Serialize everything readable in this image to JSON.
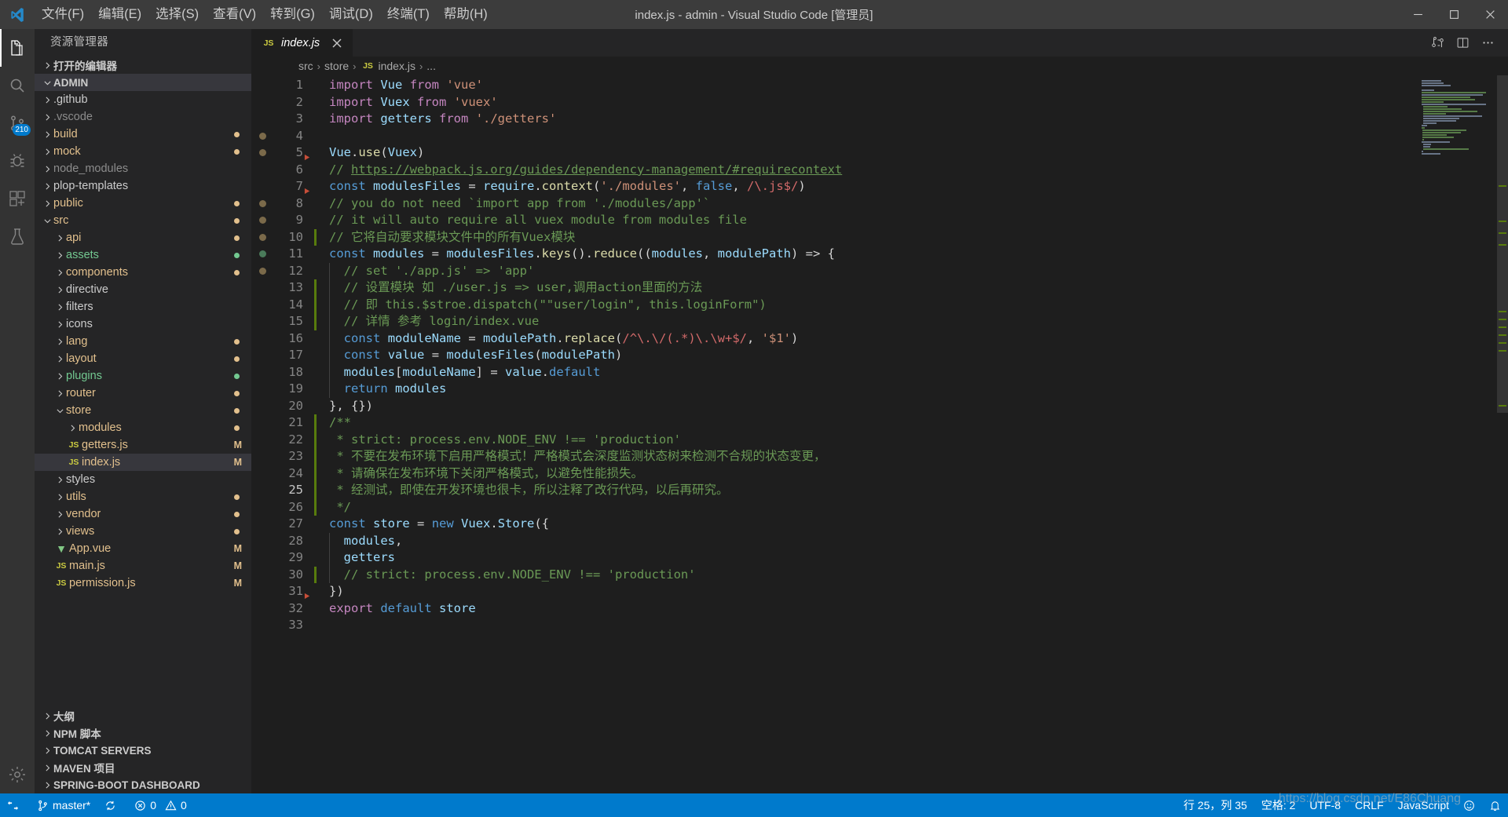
{
  "window": {
    "title": "index.js - admin - Visual Studio Code [管理员]",
    "minimize": "最小化",
    "maximize": "最大化",
    "close": "关闭"
  },
  "menubar": [
    {
      "label": "文件(F)"
    },
    {
      "label": "编辑(E)"
    },
    {
      "label": "选择(S)"
    },
    {
      "label": "查看(V)"
    },
    {
      "label": "转到(G)"
    },
    {
      "label": "调试(D)"
    },
    {
      "label": "终端(T)"
    },
    {
      "label": "帮助(H)"
    }
  ],
  "activitybar": [
    {
      "name": "explorer",
      "icon": "files-icon",
      "active": true,
      "badge": ""
    },
    {
      "name": "search",
      "icon": "search-icon",
      "active": false,
      "badge": ""
    },
    {
      "name": "source-control",
      "icon": "source-control-icon",
      "active": false,
      "badge": "210"
    },
    {
      "name": "debug",
      "icon": "debug-icon",
      "active": false,
      "badge": ""
    },
    {
      "name": "extensions",
      "icon": "extensions-icon",
      "active": false,
      "badge": ""
    },
    {
      "name": "test",
      "icon": "beaker-icon",
      "active": false,
      "badge": ""
    },
    {
      "name": "settings",
      "icon": "gear-icon",
      "active": false,
      "badge": ""
    }
  ],
  "sidebar": {
    "title": "资源管理器",
    "sections": {
      "open_editors": "打开的编辑器",
      "workspace": "ADMIN"
    },
    "tree": [
      {
        "label": ".github",
        "depth": 1,
        "type": "folder",
        "open": false,
        "color": "#cccccc",
        "badge": "",
        "dot": ""
      },
      {
        "label": ".vscode",
        "depth": 1,
        "type": "folder",
        "open": false,
        "color": "#8c8c8c",
        "badge": "",
        "dot": ""
      },
      {
        "label": "build",
        "depth": 1,
        "type": "folder",
        "open": false,
        "color": "#e2c08d",
        "badge": "",
        "dot": "#e2c08d"
      },
      {
        "label": "mock",
        "depth": 1,
        "type": "folder",
        "open": false,
        "color": "#e2c08d",
        "badge": "",
        "dot": "#e2c08d"
      },
      {
        "label": "node_modules",
        "depth": 1,
        "type": "folder",
        "open": false,
        "color": "#8c8c8c",
        "badge": "",
        "dot": ""
      },
      {
        "label": "plop-templates",
        "depth": 1,
        "type": "folder",
        "open": false,
        "color": "#cccccc",
        "badge": "",
        "dot": ""
      },
      {
        "label": "public",
        "depth": 1,
        "type": "folder",
        "open": false,
        "color": "#e2c08d",
        "badge": "",
        "dot": "#e2c08d"
      },
      {
        "label": "src",
        "depth": 1,
        "type": "folder",
        "open": true,
        "color": "#e2c08d",
        "badge": "",
        "dot": "#e2c08d"
      },
      {
        "label": "api",
        "depth": 2,
        "type": "folder",
        "open": false,
        "color": "#e2c08d",
        "badge": "",
        "dot": "#e2c08d"
      },
      {
        "label": "assets",
        "depth": 2,
        "type": "folder",
        "open": false,
        "color": "#73c991",
        "badge": "",
        "dot": "#73c991"
      },
      {
        "label": "components",
        "depth": 2,
        "type": "folder",
        "open": false,
        "color": "#e2c08d",
        "badge": "",
        "dot": "#e2c08d"
      },
      {
        "label": "directive",
        "depth": 2,
        "type": "folder",
        "open": false,
        "color": "#cccccc",
        "badge": "",
        "dot": ""
      },
      {
        "label": "filters",
        "depth": 2,
        "type": "folder",
        "open": false,
        "color": "#cccccc",
        "badge": "",
        "dot": ""
      },
      {
        "label": "icons",
        "depth": 2,
        "type": "folder",
        "open": false,
        "color": "#cccccc",
        "badge": "",
        "dot": ""
      },
      {
        "label": "lang",
        "depth": 2,
        "type": "folder",
        "open": false,
        "color": "#e2c08d",
        "badge": "",
        "dot": "#e2c08d"
      },
      {
        "label": "layout",
        "depth": 2,
        "type": "folder",
        "open": false,
        "color": "#e2c08d",
        "badge": "",
        "dot": "#e2c08d"
      },
      {
        "label": "plugins",
        "depth": 2,
        "type": "folder",
        "open": false,
        "color": "#73c991",
        "badge": "",
        "dot": "#73c991"
      },
      {
        "label": "router",
        "depth": 2,
        "type": "folder",
        "open": false,
        "color": "#e2c08d",
        "badge": "",
        "dot": "#e2c08d"
      },
      {
        "label": "store",
        "depth": 2,
        "type": "folder",
        "open": true,
        "color": "#e2c08d",
        "badge": "",
        "dot": "#e2c08d"
      },
      {
        "label": "modules",
        "depth": 3,
        "type": "folder",
        "open": false,
        "color": "#e2c08d",
        "badge": "",
        "dot": "#e2c08d"
      },
      {
        "label": "getters.js",
        "depth": 3,
        "type": "js",
        "open": false,
        "color": "#e2c08d",
        "badge": "M",
        "dot": ""
      },
      {
        "label": "index.js",
        "depth": 3,
        "type": "js",
        "open": false,
        "color": "#e2c08d",
        "badge": "M",
        "dot": "",
        "selected": true
      },
      {
        "label": "styles",
        "depth": 2,
        "type": "folder",
        "open": false,
        "color": "#cccccc",
        "badge": "",
        "dot": ""
      },
      {
        "label": "utils",
        "depth": 2,
        "type": "folder",
        "open": false,
        "color": "#e2c08d",
        "badge": "",
        "dot": "#e2c08d"
      },
      {
        "label": "vendor",
        "depth": 2,
        "type": "folder",
        "open": false,
        "color": "#e2c08d",
        "badge": "",
        "dot": "#e2c08d"
      },
      {
        "label": "views",
        "depth": 2,
        "type": "folder",
        "open": false,
        "color": "#e2c08d",
        "badge": "",
        "dot": "#e2c08d"
      },
      {
        "label": "App.vue",
        "depth": 2,
        "type": "vue",
        "open": false,
        "color": "#e2c08d",
        "badge": "M",
        "dot": ""
      },
      {
        "label": "main.js",
        "depth": 2,
        "type": "js",
        "open": false,
        "color": "#e2c08d",
        "badge": "M",
        "dot": ""
      },
      {
        "label": "permission.js",
        "depth": 2,
        "type": "js",
        "open": false,
        "color": "#e2c08d",
        "badge": "M",
        "dot": ""
      }
    ],
    "bottom_sections": [
      {
        "label": "大纲"
      },
      {
        "label": "NPM 脚本"
      },
      {
        "label": "TOMCAT SERVERS"
      },
      {
        "label": "MAVEN 项目"
      },
      {
        "label": "SPRING-BOOT DASHBOARD"
      }
    ]
  },
  "editor": {
    "tab": {
      "label": "index.js",
      "icon": "js-icon",
      "close": "×",
      "dirty": false
    },
    "tab_actions": [
      {
        "name": "split-editor-icon"
      },
      {
        "name": "open-changes-icon"
      },
      {
        "name": "more-actions-icon"
      }
    ],
    "breadcrumb": [
      "src",
      "store",
      "index.js",
      "..."
    ],
    "lines": [
      {
        "n": 1,
        "git": "",
        "dot": "",
        "fold": false,
        "text": "import Vue from 'vue'"
      },
      {
        "n": 2,
        "git": "",
        "dot": "",
        "fold": false,
        "text": "import Vuex from 'vuex'"
      },
      {
        "n": 3,
        "git": "",
        "dot": "",
        "fold": false,
        "text": "import getters from './getters'"
      },
      {
        "n": 4,
        "git": "",
        "dot": "#7b6a4a",
        "fold": false,
        "text": ""
      },
      {
        "n": 5,
        "git": "",
        "dot": "#7b6a4a",
        "fold": true,
        "text": "Vue.use(Vuex)"
      },
      {
        "n": 6,
        "git": "",
        "dot": "",
        "fold": false,
        "text": "// https://webpack.js.org/guides/dependency-management/#requirecontext"
      },
      {
        "n": 7,
        "git": "",
        "dot": "",
        "fold": true,
        "text": "const modulesFiles = require.context('./modules', false, /\\.js$/)"
      },
      {
        "n": 8,
        "git": "",
        "dot": "#7b6a4a",
        "fold": false,
        "text": "// you do not need `import app from './modules/app'`"
      },
      {
        "n": 9,
        "git": "",
        "dot": "#7b6a4a",
        "fold": false,
        "text": "// it will auto require all vuex module from modules file"
      },
      {
        "n": 10,
        "git": "added",
        "dot": "#7b6a4a",
        "fold": false,
        "text": "// 它将自动要求模块文件中的所有Vuex模块"
      },
      {
        "n": 11,
        "git": "",
        "dot": "#4a7b5a",
        "fold": false,
        "text": "const modules = modulesFiles.keys().reduce((modules, modulePath) => {"
      },
      {
        "n": 12,
        "git": "",
        "dot": "#7b6a4a",
        "fold": false,
        "text": "  // set './app.js' => 'app'"
      },
      {
        "n": 13,
        "git": "added",
        "dot": "",
        "fold": false,
        "text": "  // 设置模块 如 ./user.js => user,调用action里面的方法"
      },
      {
        "n": 14,
        "git": "added",
        "dot": "",
        "fold": false,
        "text": "  // 即 this.$stroe.dispatch(\"\"user/login\", this.loginForm\")"
      },
      {
        "n": 15,
        "git": "added",
        "dot": "",
        "fold": false,
        "text": "  // 详情 参考 login/index.vue"
      },
      {
        "n": 16,
        "git": "",
        "dot": "",
        "fold": false,
        "text": "  const moduleName = modulePath.replace(/^\\.\\/(.*)\\.\\w+$/, '$1')"
      },
      {
        "n": 17,
        "git": "",
        "dot": "",
        "fold": false,
        "text": "  const value = modulesFiles(modulePath)"
      },
      {
        "n": 18,
        "git": "",
        "dot": "",
        "fold": false,
        "text": "  modules[moduleName] = value.default"
      },
      {
        "n": 19,
        "git": "",
        "dot": "",
        "fold": false,
        "text": "  return modules"
      },
      {
        "n": 20,
        "git": "",
        "dot": "",
        "fold": false,
        "text": "}, {})"
      },
      {
        "n": 21,
        "git": "added",
        "dot": "",
        "fold": false,
        "text": "/**"
      },
      {
        "n": 22,
        "git": "added",
        "dot": "",
        "fold": false,
        "text": " * strict: process.env.NODE_ENV !== 'production'"
      },
      {
        "n": 23,
        "git": "added",
        "dot": "",
        "fold": false,
        "text": " * 不要在发布环境下启用严格模式！严格模式会深度监测状态树来检测不合规的状态变更，"
      },
      {
        "n": 24,
        "git": "added",
        "dot": "",
        "fold": false,
        "text": " * 请确保在发布环境下关闭严格模式，以避免性能损失。"
      },
      {
        "n": 25,
        "git": "added",
        "dot": "",
        "fold": false,
        "text": " * 经测试，即使在开发环境也很卡，所以注释了改行代码，以后再研究。"
      },
      {
        "n": 26,
        "git": "added",
        "dot": "",
        "fold": false,
        "text": " */"
      },
      {
        "n": 27,
        "git": "",
        "dot": "",
        "fold": false,
        "text": "const store = new Vuex.Store({"
      },
      {
        "n": 28,
        "git": "",
        "dot": "",
        "fold": false,
        "text": "  modules,"
      },
      {
        "n": 29,
        "git": "",
        "dot": "",
        "fold": false,
        "text": "  getters"
      },
      {
        "n": 30,
        "git": "added",
        "dot": "",
        "fold": false,
        "text": "  // strict: process.env.NODE_ENV !== 'production'"
      },
      {
        "n": 31,
        "git": "",
        "dot": "",
        "fold": true,
        "text": "})"
      },
      {
        "n": 32,
        "git": "",
        "dot": "",
        "fold": false,
        "text": "export default store"
      },
      {
        "n": 33,
        "git": "",
        "dot": "",
        "fold": false,
        "text": ""
      }
    ]
  },
  "statusbar": {
    "left": [
      {
        "name": "remote-icon",
        "icon": "remote-icon",
        "label": ""
      },
      {
        "name": "branch",
        "icon": "branch-icon",
        "label": "master*"
      },
      {
        "name": "sync",
        "icon": "sync-icon",
        "label": ""
      },
      {
        "name": "errors",
        "icon": "error-icon",
        "label": "0"
      },
      {
        "name": "warnings",
        "icon": "warning-icon",
        "label": "0"
      }
    ],
    "right": [
      {
        "name": "cursor-position",
        "label": "行 25，列 35"
      },
      {
        "name": "indentation",
        "label": "空格: 2"
      },
      {
        "name": "encoding",
        "label": "UTF-8"
      },
      {
        "name": "eol",
        "label": "CRLF"
      },
      {
        "name": "language-mode",
        "label": "JavaScript"
      },
      {
        "name": "feedback",
        "label": "☺"
      },
      {
        "name": "notifications",
        "label": "🔔"
      }
    ]
  },
  "watermark": "https://blog.csdn.net/E86Chuang",
  "colors": {
    "accent": "#007acc",
    "titlebar": "#3c3c3c",
    "sidebar": "#252526",
    "editor": "#1e1e1e",
    "activitybar": "#333333",
    "selection": "#37373d",
    "modified": "#e2c08d",
    "untracked": "#73c991",
    "git_added_bar": "#587c0c"
  }
}
